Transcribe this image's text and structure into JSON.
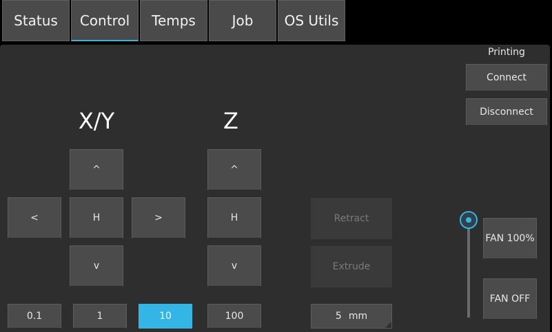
{
  "tabs": [
    {
      "label": "Status"
    },
    {
      "label": "Control"
    },
    {
      "label": "Temps"
    },
    {
      "label": "Job"
    },
    {
      "label": "OS Utils"
    }
  ],
  "active_tab": "Control",
  "xy": {
    "title": "X/Y",
    "up": "^",
    "left": "<",
    "home": "H",
    "right": ">",
    "down": "v"
  },
  "z": {
    "title": "Z",
    "up": "^",
    "home": "H",
    "down": "v"
  },
  "steps": [
    "0.1",
    "1",
    "10",
    "100"
  ],
  "selected_step": "10",
  "extruder": {
    "retract": "Retract",
    "extrude": "Extrude",
    "amount": "5",
    "unit": "mm"
  },
  "connection": {
    "status": "Printing",
    "connect": "Connect",
    "disconnect": "Disconnect"
  },
  "fan": {
    "full": "FAN 100%",
    "off": "FAN OFF",
    "level_fraction": 1.0
  },
  "colors": {
    "accent": "#33b5e5",
    "panel": "#2e2e2e",
    "button": "#4b4b4b"
  }
}
